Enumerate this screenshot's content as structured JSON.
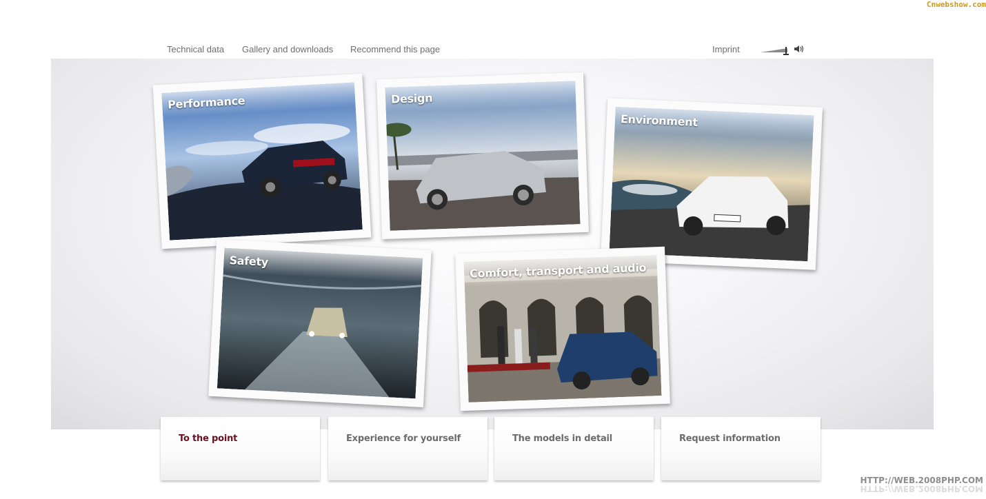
{
  "watermark_top": "Cnwebshow.com",
  "watermark_bottom": "HTTP://WEB.2008PHP.COM",
  "topnav": {
    "items": [
      {
        "label": "Technical data"
      },
      {
        "label": "Gallery and downloads"
      },
      {
        "label": "Recommend this page"
      }
    ],
    "imprint": "Imprint"
  },
  "icons": {
    "volume": "volume-slider-icon",
    "speaker": "speaker-icon"
  },
  "cards": [
    {
      "label": "Performance"
    },
    {
      "label": "Design"
    },
    {
      "label": "Environment"
    },
    {
      "label": "Safety"
    },
    {
      "label": "Comfort, transport and audio"
    }
  ],
  "tabs": [
    {
      "label": "To the point",
      "active": true
    },
    {
      "label": "Experience for yourself",
      "active": false
    },
    {
      "label": "The models in detail",
      "active": false
    },
    {
      "label": "Request information",
      "active": false
    }
  ],
  "colors": {
    "active_tab": "#6b0f1f",
    "tab_text": "#6c6c6c",
    "nav_text": "#6e6e6e",
    "watermark_top": "#c89a1e"
  }
}
